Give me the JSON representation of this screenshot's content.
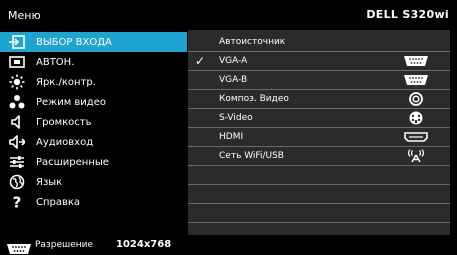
{
  "header": {
    "menu_title": "Меню",
    "model": "DELL S320wi"
  },
  "sidebar": {
    "items": [
      {
        "label": "ВЫБОР ВХОДА",
        "icon": "input-select-icon",
        "active": true
      },
      {
        "label": "АВТОН.",
        "icon": "auto-adjust-icon",
        "active": false
      },
      {
        "label": "Ярк./контр.",
        "icon": "brightness-icon",
        "active": false
      },
      {
        "label": "Режим видео",
        "icon": "video-mode-icon",
        "active": false
      },
      {
        "label": "Громкость",
        "icon": "speaker-icon",
        "active": false
      },
      {
        "label": "Аудиовход",
        "icon": "audio-input-icon",
        "active": false
      },
      {
        "label": "Расширенные",
        "icon": "advanced-settings-icon",
        "active": false
      },
      {
        "label": "Язык",
        "icon": "language-globe-icon",
        "active": false
      },
      {
        "label": "Справка",
        "icon": "help-question-icon",
        "active": false
      }
    ]
  },
  "panel": {
    "items": [
      {
        "label": "Автоисточник",
        "checked": false,
        "icon": ""
      },
      {
        "label": "VGA-A",
        "checked": true,
        "icon": "vga-connector-icon"
      },
      {
        "label": "VGA-B",
        "checked": false,
        "icon": "vga-connector-icon"
      },
      {
        "label": "Композ. Видео",
        "checked": false,
        "icon": "composite-video-icon"
      },
      {
        "label": "S-Video",
        "checked": false,
        "icon": "s-video-icon"
      },
      {
        "label": "HDMI",
        "checked": false,
        "icon": "hdmi-icon"
      },
      {
        "label": "Сеть  WiFi/USB",
        "checked": false,
        "icon": "wifi-antenna-icon"
      },
      {
        "label": "",
        "checked": false,
        "icon": ""
      },
      {
        "label": "",
        "checked": false,
        "icon": ""
      },
      {
        "label": "",
        "checked": false,
        "icon": ""
      }
    ],
    "check_glyph": "✓"
  },
  "footer": {
    "label": "Разрешение",
    "value": "1024x768",
    "icon": "vga-connector-icon"
  },
  "colors": {
    "active_highlight": "#1fa3cf",
    "panel_background": "#2b2b2b",
    "divider": "#6a6a6a",
    "text": "#ffffff"
  }
}
